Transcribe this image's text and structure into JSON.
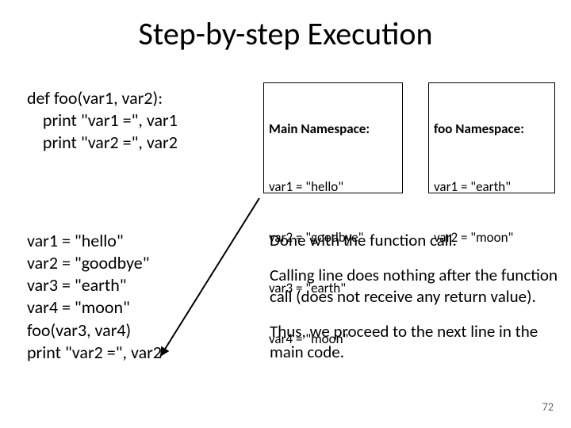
{
  "title": "Step-by-step Execution",
  "code": {
    "l1": "def foo(var1, var2):",
    "l2": "    print \"var1 =\", var1",
    "l3": "    print \"var2 =\", var2"
  },
  "assign": {
    "l1": "var1 = \"hello\"",
    "l2": "var2 = \"goodbye\"",
    "l3": "var3 = \"earth\"",
    "l4": "var4 = \"moon\"",
    "l5": "foo(var3, var4)",
    "l6": "print \"var2 =\", var2"
  },
  "ns_main": {
    "header": "Main Namespace:",
    "v1": "var1 = \"hello\"",
    "v2": "var2 = \"goodbye\"",
    "v3": "var3 = \"earth\"",
    "v4": "var4 = \"moon\""
  },
  "ns_foo": {
    "header": "foo Namespace:",
    "v1": "var1 = \"earth\"",
    "v2": "var2 = \"moon\""
  },
  "explain": {
    "p1": "Done with the function call.",
    "p2": "Calling line does nothing after the function call (does not receive any return value).",
    "p3": "Thus, we proceed to the next line in the main code."
  },
  "page_number": "72"
}
